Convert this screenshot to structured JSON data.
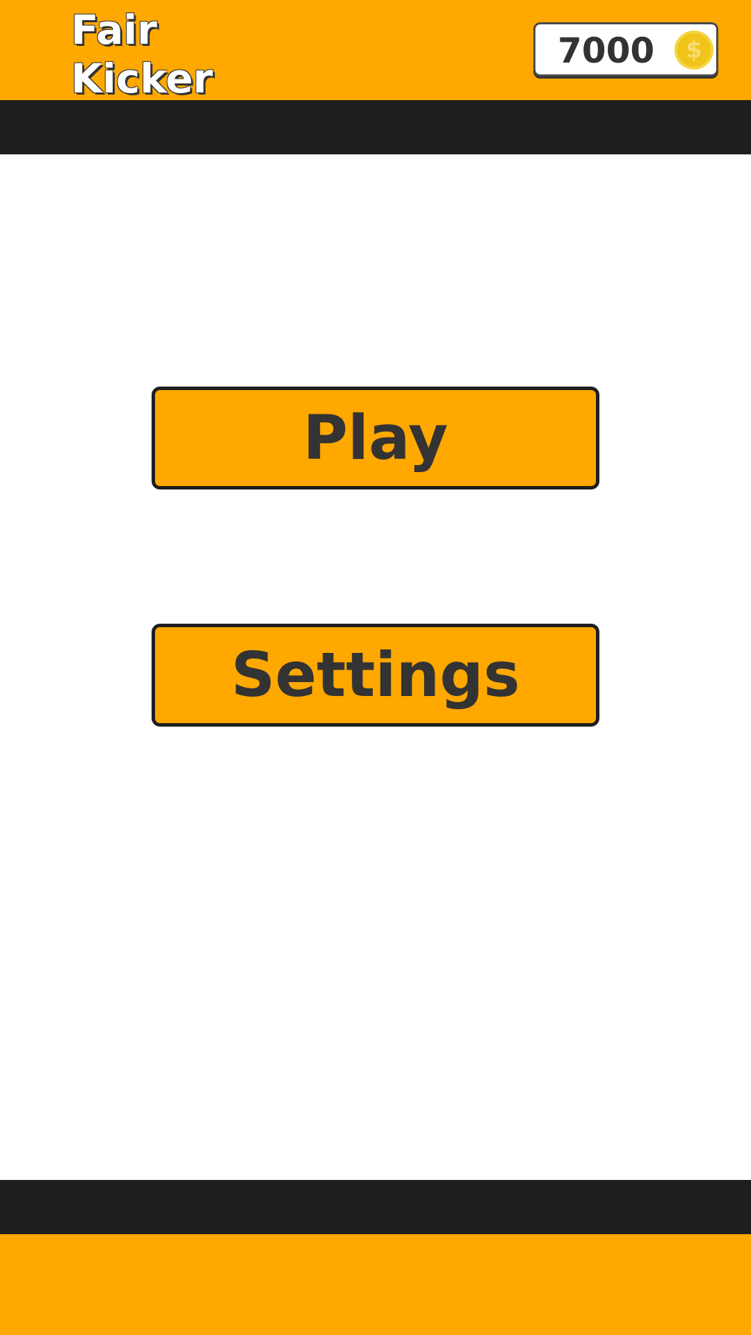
{
  "app": {
    "title_line1": "Fair",
    "title_line2": "Kicker"
  },
  "wallet": {
    "coins": "7000",
    "coin_icon": "coin-icon",
    "coin_symbol": "$"
  },
  "menu": {
    "play_label": "Play",
    "settings_label": "Settings"
  },
  "colors": {
    "accent": "#FFA800",
    "dark_band": "#1E1E1E",
    "text_dark": "#333333",
    "coin": "#F0C419"
  }
}
